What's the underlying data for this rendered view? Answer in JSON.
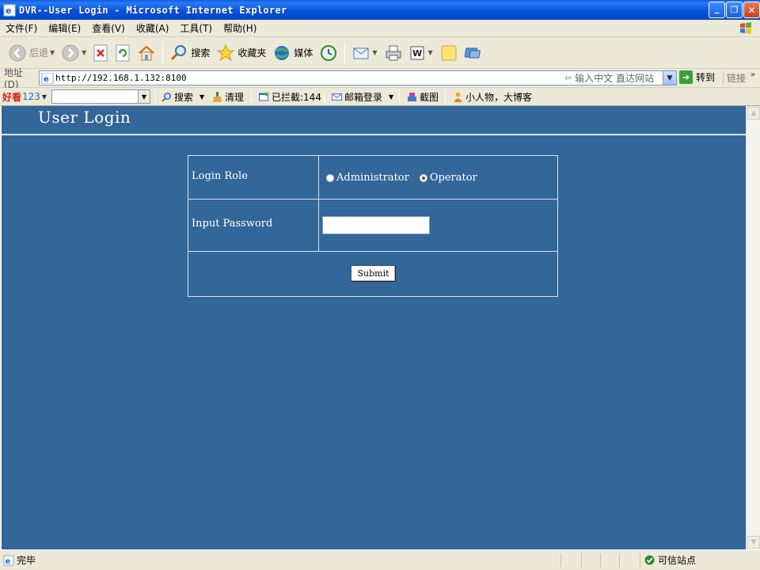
{
  "window": {
    "title": "DVR--User Login - Microsoft Internet Explorer",
    "minimize_glyph": "_",
    "maximize_glyph": "❐",
    "close_glyph": "✕"
  },
  "menu": [
    "文件(F)",
    "编辑(E)",
    "查看(V)",
    "收藏(A)",
    "工具(T)",
    "帮助(H)"
  ],
  "toolbar": {
    "back_label": "后退",
    "search_label": "搜索",
    "favorites_label": "收藏夹",
    "media_label": "媒体"
  },
  "address": {
    "label": "地址(D)",
    "url": "http://192.168.1.132:8100",
    "hint": "输入中文 直达网站",
    "go_label": "转到",
    "links_label": "链接"
  },
  "searchbar": {
    "brand_cn": "好看",
    "brand_num": "123",
    "search_label": "搜索",
    "clean_label": "清理",
    "blocked_label": "已拦截:144",
    "mail_label": "邮箱登录",
    "screenshot_label": "截图",
    "news_label": "小人物，大博客"
  },
  "page": {
    "header_title": "User Login",
    "login_role_label": "Login Role",
    "role_admin_label": "Administrator",
    "role_operator_label": "Operator",
    "selected_role": "Operator",
    "password_label": "Input Password",
    "password_value": "",
    "submit_label": "Submit"
  },
  "status": {
    "text": "完毕",
    "zone_text": "可信站点"
  },
  "colors": {
    "page_background": "#336699",
    "title_bar": "#0553dd"
  }
}
